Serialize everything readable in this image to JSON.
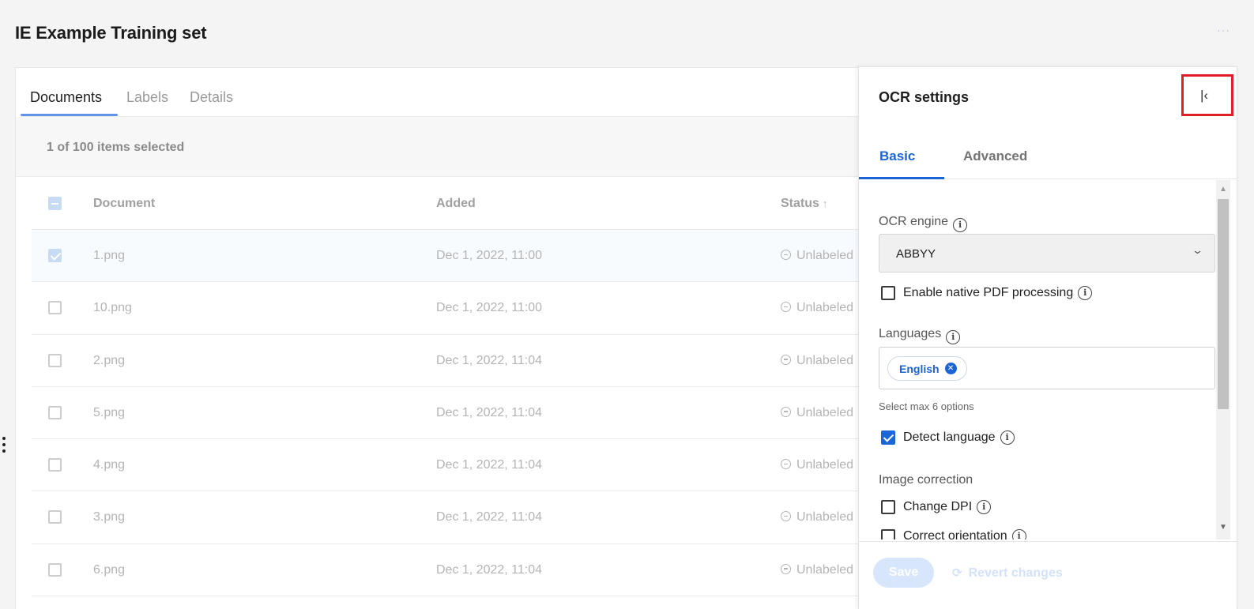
{
  "page": {
    "title": "IE Example Training set",
    "more": "···"
  },
  "main": {
    "tabs": [
      {
        "label": "Documents"
      },
      {
        "label": "Labels"
      },
      {
        "label": "Details"
      }
    ],
    "selection_text": "1 of 100 items selected",
    "columns": {
      "document": "Document",
      "added": "Added",
      "status": "Status"
    },
    "sort_arrow": "↑",
    "rows": [
      {
        "document": "1.png",
        "added": "Dec 1, 2022, 11:00",
        "status": "Unlabeled"
      },
      {
        "document": "10.png",
        "added": "Dec 1, 2022, 11:00",
        "status": "Unlabeled"
      },
      {
        "document": "2.png",
        "added": "Dec 1, 2022, 11:04",
        "status": "Unlabeled"
      },
      {
        "document": "5.png",
        "added": "Dec 1, 2022, 11:04",
        "status": "Unlabeled"
      },
      {
        "document": "4.png",
        "added": "Dec 1, 2022, 11:04",
        "status": "Unlabeled"
      },
      {
        "document": "3.png",
        "added": "Dec 1, 2022, 11:04",
        "status": "Unlabeled"
      },
      {
        "document": "6.png",
        "added": "Dec 1, 2022, 11:04",
        "status": "Unlabeled"
      }
    ]
  },
  "panel": {
    "title": "OCR settings",
    "collapse_icon": "K",
    "tabs": [
      {
        "label": "Basic"
      },
      {
        "label": "Advanced"
      }
    ],
    "ocr_engine": {
      "label": "OCR engine",
      "value": "ABBYY"
    },
    "native_pdf": {
      "label": "Enable native PDF processing",
      "checked": false
    },
    "languages": {
      "label": "Languages",
      "chips": [
        {
          "label": "English"
        }
      ],
      "hint": "Select max 6 options"
    },
    "detect_language": {
      "label": "Detect language",
      "checked": true
    },
    "image_correction": {
      "label": "Image correction",
      "options": [
        {
          "label": "Change DPI"
        },
        {
          "label": "Correct orientation"
        }
      ]
    },
    "footer": {
      "save": "Save",
      "revert": "Revert changes"
    }
  }
}
